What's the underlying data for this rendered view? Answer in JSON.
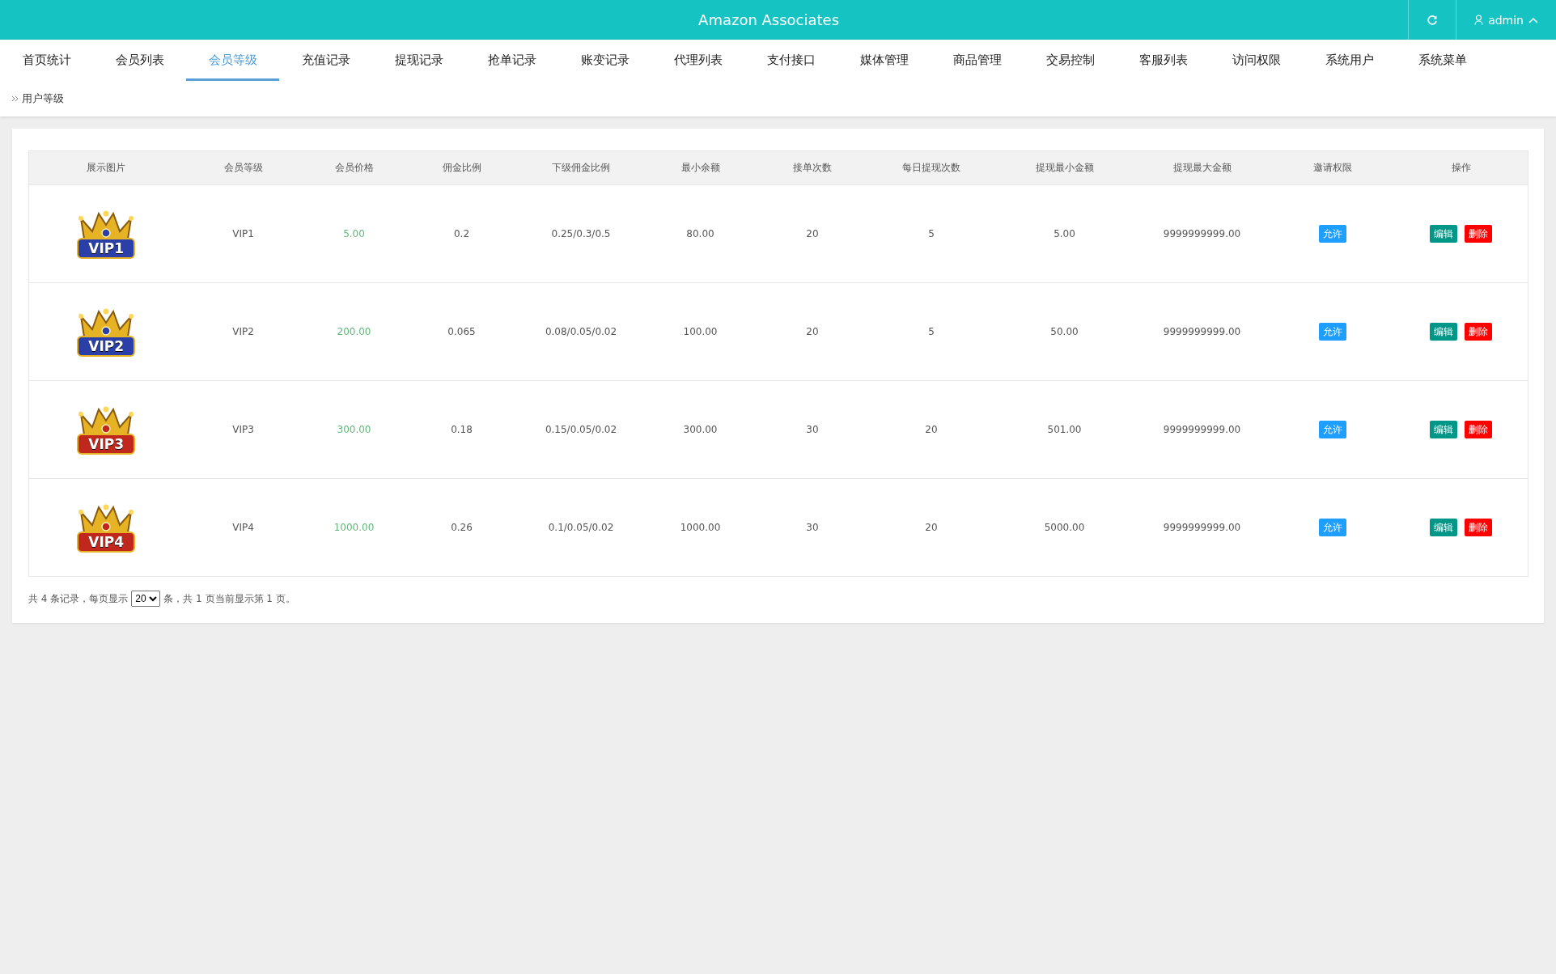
{
  "topbar": {
    "title": "Amazon Associates",
    "user": "admin"
  },
  "nav": [
    {
      "label": "首页统计",
      "selected": false
    },
    {
      "label": "会员列表",
      "selected": false
    },
    {
      "label": "会员等级",
      "selected": true
    },
    {
      "label": "充值记录",
      "selected": false
    },
    {
      "label": "提现记录",
      "selected": false
    },
    {
      "label": "抢单记录",
      "selected": false
    },
    {
      "label": "账变记录",
      "selected": false
    },
    {
      "label": "代理列表",
      "selected": false
    },
    {
      "label": "支付接口",
      "selected": false
    },
    {
      "label": "媒体管理",
      "selected": false
    },
    {
      "label": "商品管理",
      "selected": false
    },
    {
      "label": "交易控制",
      "selected": false
    },
    {
      "label": "客服列表",
      "selected": false
    },
    {
      "label": "访问权限",
      "selected": false
    },
    {
      "label": "系统用户",
      "selected": false
    },
    {
      "label": "系统菜单",
      "selected": false
    }
  ],
  "breadcrumb": "用户等级",
  "table": {
    "columns": [
      "展示图片",
      "会员等级",
      "会员价格",
      "佣金比例",
      "下级佣金比例",
      "最小余额",
      "接单次数",
      "每日提现次数",
      "提现最小金额",
      "提现最大金额",
      "邀请权限",
      "操作"
    ],
    "rows": [
      {
        "image": {
          "label": "VIP1",
          "color": "#2a3fa8"
        },
        "level": "VIP1",
        "price": "5.00",
        "commission": "0.2",
        "sub_commission": "0.25/0.3/0.5",
        "min_balance": "80.00",
        "orders": "20",
        "daily_withdrawals": "5",
        "withdraw_min": "5.00",
        "withdraw_max": "9999999999.00",
        "invite": "允许",
        "actions": [
          "编辑",
          "删除"
        ]
      },
      {
        "image": {
          "label": "VIP2",
          "color": "#2a3fa8"
        },
        "level": "VIP2",
        "price": "200.00",
        "commission": "0.065",
        "sub_commission": "0.08/0.05/0.02",
        "min_balance": "100.00",
        "orders": "20",
        "daily_withdrawals": "5",
        "withdraw_min": "50.00",
        "withdraw_max": "9999999999.00",
        "invite": "允许",
        "actions": [
          "编辑",
          "删除"
        ]
      },
      {
        "image": {
          "label": "VIP3",
          "color": "#c0281e"
        },
        "level": "VIP3",
        "price": "300.00",
        "commission": "0.18",
        "sub_commission": "0.15/0.05/0.02",
        "min_balance": "300.00",
        "orders": "30",
        "daily_withdrawals": "20",
        "withdraw_min": "501.00",
        "withdraw_max": "9999999999.00",
        "invite": "允许",
        "actions": [
          "编辑",
          "删除"
        ]
      },
      {
        "image": {
          "label": "VIP4",
          "color": "#c0281e"
        },
        "level": "VIP4",
        "price": "1000.00",
        "commission": "0.26",
        "sub_commission": "0.1/0.05/0.02",
        "min_balance": "1000.00",
        "orders": "30",
        "daily_withdrawals": "20",
        "withdraw_min": "5000.00",
        "withdraw_max": "9999999999.00",
        "invite": "允许",
        "actions": [
          "编辑",
          "删除"
        ]
      }
    ]
  },
  "pager": {
    "before": "共 4 条记录，每页显示",
    "page_size": "20",
    "after": "条，共 1 页当前显示第 1 页。"
  }
}
